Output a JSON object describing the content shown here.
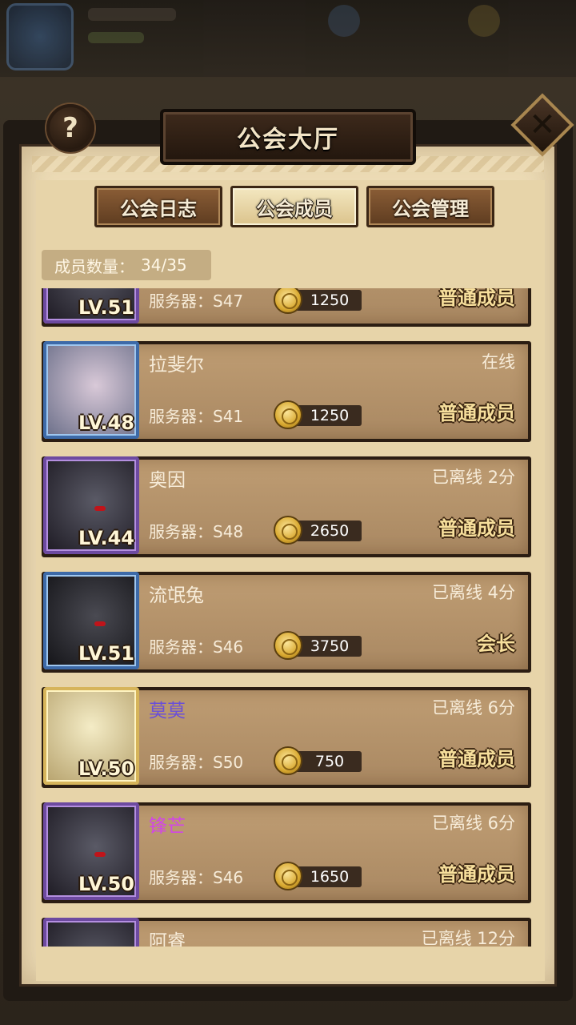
{
  "header": {
    "title": "公会大厅",
    "help_icon": "question-icon",
    "close_icon": "close-icon"
  },
  "tabs": [
    {
      "label": "公会日志",
      "active": false
    },
    {
      "label": "公会成员",
      "active": true
    },
    {
      "label": "公会管理",
      "active": false
    }
  ],
  "member_count": {
    "label": "成员数量：",
    "value": "34/35"
  },
  "members": [
    {
      "name": "",
      "status": "",
      "level": "LV.51",
      "server": "服务器：S47",
      "contribution": "1250",
      "role": "普通成员",
      "frame": "purple"
    },
    {
      "name": "拉斐尔",
      "status": "在线",
      "level": "LV.48",
      "server": "服务器：S41",
      "contribution": "1250",
      "role": "普通成员",
      "frame": "blue"
    },
    {
      "name": "奥因",
      "status": "已离线 2分",
      "level": "LV.44",
      "server": "服务器：S48",
      "contribution": "2650",
      "role": "普通成员",
      "frame": "purple"
    },
    {
      "name": "流氓兔",
      "status": "已离线 4分",
      "level": "LV.51",
      "server": "服务器：S46",
      "contribution": "3750",
      "role": "会长",
      "frame": "blue-dark"
    },
    {
      "name": "莫莫",
      "status": "已离线 6分",
      "level": "LV.50",
      "server": "服务器：S50",
      "contribution": "750",
      "role": "普通成员",
      "frame": "gold",
      "name_color": "purple"
    },
    {
      "name": "锋芒",
      "status": "已离线 6分",
      "level": "LV.50",
      "server": "服务器：S46",
      "contribution": "1650",
      "role": "普通成员",
      "frame": "purple",
      "name_color": "magenta"
    },
    {
      "name": "阿睿",
      "status": "已离线 12分",
      "level": "",
      "server": "",
      "contribution": "",
      "role": "",
      "frame": "purple"
    }
  ],
  "colors": {
    "panel": "#eddcb6",
    "card": "#b4916a",
    "frame_purple": "#6d4aa0",
    "frame_blue": "#3d6aa8",
    "frame_gold": "#d6b45a",
    "role_text": "#f7df9c"
  }
}
